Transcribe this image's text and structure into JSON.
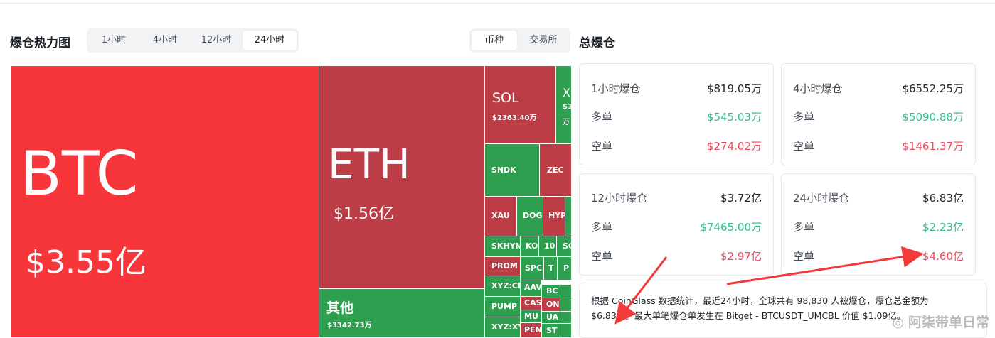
{
  "heatmap": {
    "title": "爆仓热力图",
    "time_tabs": [
      {
        "label": "1小时",
        "active": false
      },
      {
        "label": "4小时",
        "active": false
      },
      {
        "label": "12小时",
        "active": false
      },
      {
        "label": "24小时",
        "active": true
      }
    ],
    "view_tabs": [
      {
        "label": "币种",
        "active": true
      },
      {
        "label": "交易所",
        "active": false
      }
    ],
    "tiles": [
      {
        "name": "BTC",
        "amount": "$3.55亿",
        "color": "#f6363b"
      },
      {
        "name": "ETH",
        "amount": "$1.56亿",
        "color": "#bc3d45"
      },
      {
        "name": "其他",
        "amount": "$3342.73万",
        "color": "#2e9e4f"
      },
      {
        "name": "SOL",
        "amount": "$2363.40万",
        "color": "#bc3d45"
      },
      {
        "name": "X",
        "amount": "$1",
        "amount2": "万",
        "color": "#2e9e4f"
      },
      {
        "name": "SNDK",
        "color": "#2e9e4f"
      },
      {
        "name": "ZEC",
        "color": "#bc3d45"
      },
      {
        "name": "XAU",
        "color": "#bc3d45"
      },
      {
        "name": "DOG",
        "color": "#2e9e4f"
      },
      {
        "name": "HYP",
        "color": "#bc3d45"
      },
      {
        "name": "SKHYN",
        "color": "#2e9e4f"
      },
      {
        "name": "KO",
        "color": "#2e9e4f"
      },
      {
        "name": "10",
        "color": "#2e9e4f"
      },
      {
        "name": "SC",
        "color": "#2e9e4f"
      },
      {
        "name": "PROM",
        "color": "#bc3d45"
      },
      {
        "name": "SPC",
        "color": "#2e9e4f"
      },
      {
        "name": "T",
        "color": "#2e9e4f"
      },
      {
        "name": "P",
        "color": "#2e9e4f"
      },
      {
        "name": "XYZ:CI",
        "color": "#2e9e4f"
      },
      {
        "name": "AAV",
        "color": "#2e9e4f"
      },
      {
        "name": "BC",
        "color": "#2e9e4f"
      },
      {
        "name": "PUMP",
        "color": "#2e9e4f"
      },
      {
        "name": "CAS",
        "color": "#bc3d45"
      },
      {
        "name": "ON",
        "color": "#bc3d45"
      },
      {
        "name": "MU",
        "color": "#2e9e4f"
      },
      {
        "name": "UA",
        "color": "#2e9e4f"
      },
      {
        "name": "XYZ:XY",
        "color": "#2e9e4f"
      },
      {
        "name": "PEN",
        "color": "#bc3d45"
      },
      {
        "name": "ST",
        "color": "#2e9e4f"
      }
    ]
  },
  "total": {
    "title": "总爆仓",
    "cards": [
      {
        "label": "1小时爆仓",
        "value": "$819.05万",
        "long_label": "多单",
        "long_value": "$545.03万",
        "short_label": "空单",
        "short_value": "$274.02万"
      },
      {
        "label": "4小时爆仓",
        "value": "$6552.25万",
        "long_label": "多单",
        "long_value": "$5090.88万",
        "short_label": "空单",
        "short_value": "$1461.37万"
      },
      {
        "label": "12小时爆仓",
        "value": "$3.72亿",
        "long_label": "多单",
        "long_value": "$7465.00万",
        "short_label": "空单",
        "short_value": "$2.97亿"
      },
      {
        "label": "24小时爆仓",
        "value": "$6.83亿",
        "long_label": "多单",
        "long_value": "$2.23亿",
        "short_label": "空单",
        "short_value": "$4.60亿"
      }
    ],
    "summary_line1": "根据 CoinGlass 数据统计，最近24小时，全球共有 98,830 人被爆仓，爆仓总金额为",
    "summary_line2": "$6.83亿。最大单笔爆仓单发生在 Bitget - BTCUSDT_UMCBL 价值 $1.09亿。"
  },
  "watermark": {
    "icon": "weibo-icon",
    "text": "阿柒带单日常"
  },
  "colors": {
    "long": "#2ebd85",
    "short": "#f6465d",
    "arrow": "#f23a3a"
  }
}
